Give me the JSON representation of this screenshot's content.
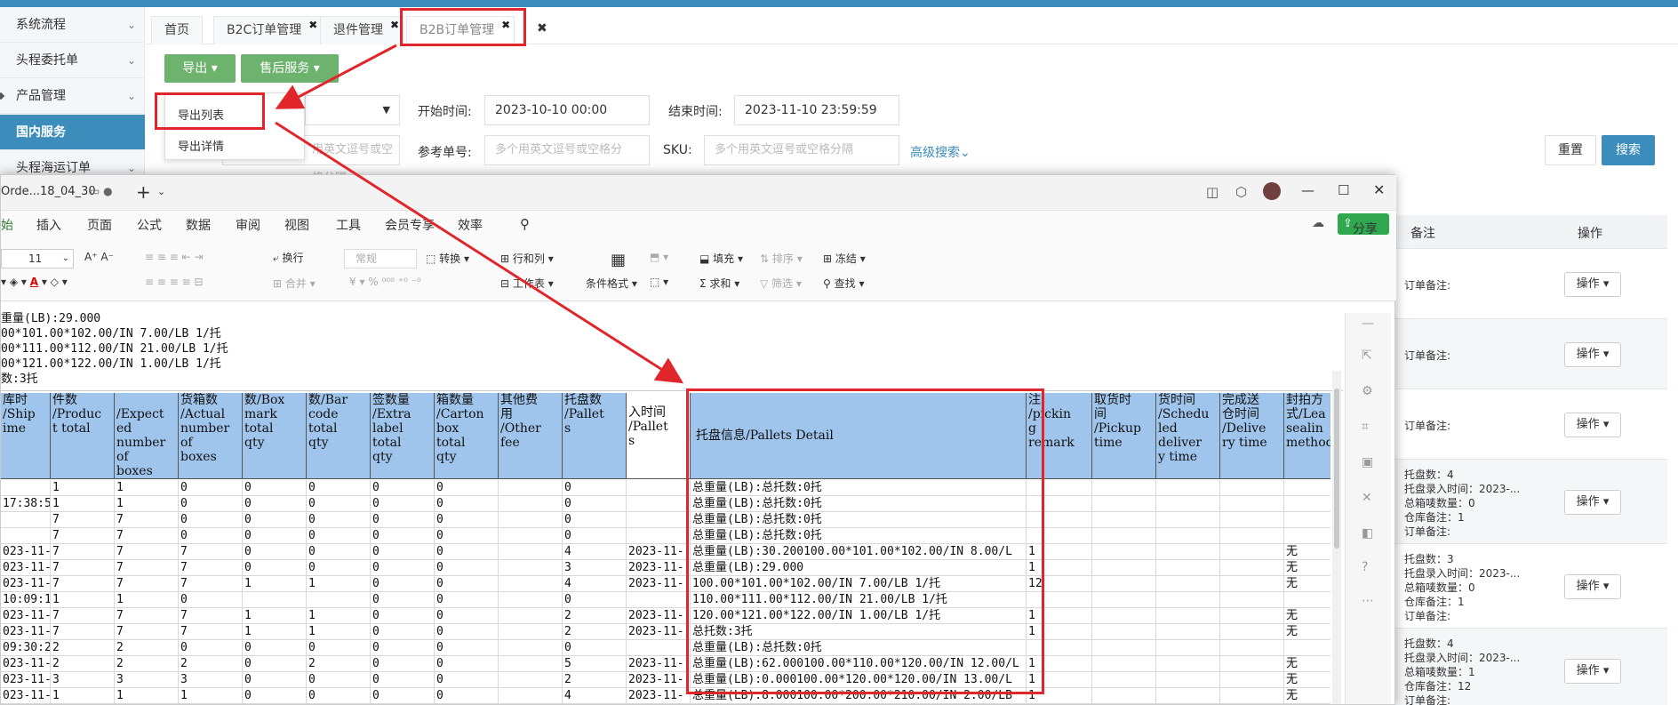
{
  "sidebar": {
    "items": [
      {
        "label": "系统流程"
      },
      {
        "label": "头程委托单"
      },
      {
        "label": "产品管理"
      },
      {
        "label": "国内服务"
      },
      {
        "label": "头程海运订单"
      }
    ]
  },
  "tabs": [
    {
      "label": "首页"
    },
    {
      "label": "B2C订单管理"
    },
    {
      "label": "退件管理"
    },
    {
      "label": "B2B订单管理"
    }
  ],
  "toolbar": {
    "export": "导出",
    "after_sales": "售后服务"
  },
  "export_menu": {
    "list": "导出列表",
    "detail": "导出详情"
  },
  "filters": {
    "start_label": "开始时间:",
    "start_value": "2023-10-10 00:00",
    "end_label": "结束时间:",
    "end_value": "2023-11-10 23:59:59",
    "left_placeholder": "用英文逗号或空格分隔",
    "ref_label": "参考单号:",
    "ref_placeholder": "多个用英文逗号或空格分",
    "sku_label": "SKU:",
    "sku_placeholder": "多个用英文逗号或空格分隔",
    "advanced": "高级搜索",
    "reset": "重置",
    "search": "搜索"
  },
  "right_table": {
    "header_note": "备注",
    "header_op": "操作",
    "op_label": "操作",
    "rows": [
      {
        "lines": [
          "订单备注:"
        ]
      },
      {
        "lines": [
          "订单备注:"
        ]
      },
      {
        "lines": [
          "订单备注:"
        ]
      },
      {
        "lines": [
          "托盘数：4",
          "托盘录入时间：2023-...",
          "总箱唛数量：0",
          "仓库备注：1",
          "订单备注:"
        ]
      },
      {
        "lines": [
          "托盘数：3",
          "托盘录入时间：2023-...",
          "总箱唛数量：0",
          "仓库备注：1",
          "订单备注:"
        ]
      },
      {
        "lines": [
          "托盘数：4",
          "托盘录入时间：2023-...",
          "总箱唛数量：1",
          "仓库备注：12",
          "订单备注:"
        ]
      }
    ]
  },
  "excel": {
    "title": "Orde...18_04_30",
    "share": "分享",
    "menu": [
      "开始",
      "插入",
      "页面",
      "公式",
      "数据",
      "审阅",
      "视图",
      "工具",
      "会员专享",
      "效率"
    ],
    "ribbon": {
      "font_size": "11",
      "wrap": "换行",
      "number_format": "常规",
      "convert": "转换",
      "row_col": "行和列",
      "worksheet": "工作表",
      "cond_format": "条件格式",
      "fill": "填充",
      "sort": "排序",
      "freeze": "冻结",
      "merge": "合并",
      "sum": "求和",
      "filter": "筛选",
      "find": "查找"
    },
    "formula_lines": [
      "重量(LB):29.000",
      "00*101.00*102.00/IN 7.00/LB 1/托",
      "00*111.00*112.00/IN 21.00/LB 1/托",
      "00*121.00*122.00/IN 1.00/LB 1/托",
      "数:3托"
    ],
    "headers": [
      "库时\n/Ship\nime",
      "件数\n/Produc\nt total",
      "\n/Expect\ned\nnumber\nof\nboxes",
      "货箱数\n/Actual\nnumber\nof\nboxes",
      "数/Box\nmark\ntotal\nqty",
      "数/Bar\ncode\ntotal\nqty",
      "签数量\n/Extra\nlabel\ntotal\nqty",
      "箱数量\n/Carton\nbox\ntotal\nqty",
      "其他费\n用\n/Other\nfee",
      "托盘数\n/Pallet\ns",
      "入时间\n/Pallet\ns",
      "托盘信息/Pallets Detail",
      "注\n/pickin\ng\nremark",
      "取货时\n间\n/Pickup\ntime",
      "货时间\n/Schedu\nled\ndeliver\ny time",
      "完成送\n仓时间\n/Delive\nry time",
      "封拍方\n式/Lea\nsealin\nmethod"
    ],
    "rows": [
      [
        "",
        "1",
        "1",
        "0",
        "0",
        "0",
        "0",
        "0",
        "",
        "0",
        "",
        "总重量(LB):总托数:0托",
        "",
        "",
        "",
        "",
        ""
      ],
      [
        "17:38:5",
        "1",
        "1",
        "0",
        "0",
        "0",
        "0",
        "0",
        "",
        "0",
        "",
        "总重量(LB):总托数:0托",
        "",
        "",
        "",
        "",
        ""
      ],
      [
        "",
        "7",
        "7",
        "0",
        "0",
        "0",
        "0",
        "0",
        "",
        "0",
        "",
        "总重量(LB):总托数:0托",
        "",
        "",
        "",
        "",
        ""
      ],
      [
        "",
        "7",
        "7",
        "0",
        "0",
        "0",
        "0",
        "0",
        "",
        "0",
        "",
        "总重量(LB):总托数:0托",
        "",
        "",
        "",
        "",
        ""
      ],
      [
        "023-11-0",
        "7",
        "7",
        "7",
        "0",
        "0",
        "0",
        "0",
        "",
        "4",
        "2023-11-",
        "总重量(LB):30.200100.00*101.00*102.00/IN 8.00/L",
        "1",
        "",
        "",
        "",
        "无"
      ],
      [
        "023-11-0",
        "7",
        "7",
        "7",
        "0",
        "0",
        "0",
        "0",
        "",
        "3",
        "2023-11-",
        "总重量(LB):29.000",
        "1",
        "",
        "",
        "",
        "无"
      ],
      [
        "023-11-0",
        "7",
        "7",
        "7",
        "1",
        "1",
        "0",
        "0",
        "",
        "4",
        "2023-11-",
        "100.00*101.00*102.00/IN 7.00/LB 1/托",
        "12",
        "",
        "",
        "",
        "无"
      ],
      [
        "10:09:1",
        "1",
        "1",
        "0",
        "",
        "",
        "0",
        "0",
        "",
        "0",
        "",
        "110.00*111.00*112.00/IN 21.00/LB 1/托",
        "",
        "",
        "",
        "",
        ""
      ],
      [
        "023-11-0",
        "7",
        "7",
        "7",
        "1",
        "1",
        "0",
        "0",
        "",
        "2",
        "2023-11-",
        "120.00*121.00*122.00/IN 1.00/LB 1/托",
        "1",
        "",
        "",
        "",
        "无"
      ],
      [
        "023-11-0",
        "7",
        "7",
        "7",
        "1",
        "1",
        "0",
        "0",
        "",
        "2",
        "2023-11-",
        "总托数:3托",
        "1",
        "",
        "",
        "",
        "无"
      ],
      [
        "09:30:2",
        "2",
        "2",
        "0",
        "0",
        "0",
        "0",
        "0",
        "",
        "0",
        "",
        "总重量(LB):总托数:0托",
        "",
        "",
        "",
        "",
        ""
      ],
      [
        "023-11-0",
        "2",
        "2",
        "2",
        "0",
        "2",
        "0",
        "0",
        "",
        "5",
        "2023-11-",
        "总重量(LB):62.000100.00*110.00*120.00/IN 12.00/L",
        "1",
        "",
        "",
        "",
        "无"
      ],
      [
        "023-11-0",
        "3",
        "3",
        "3",
        "0",
        "0",
        "0",
        "0",
        "",
        "2",
        "2023-11-",
        "总重量(LB):0.000100.00*120.00*120.00/IN 13.00/L",
        "1",
        "",
        "",
        "",
        "无"
      ],
      [
        "023-11-0",
        "1",
        "1",
        "1",
        "0",
        "0",
        "0",
        "0",
        "",
        "4",
        "2023-11-",
        "总重量(LB):8.000100.00*200.00*210.00/IN 2.00/LB",
        "1",
        "",
        "",
        "",
        "无"
      ]
    ]
  }
}
